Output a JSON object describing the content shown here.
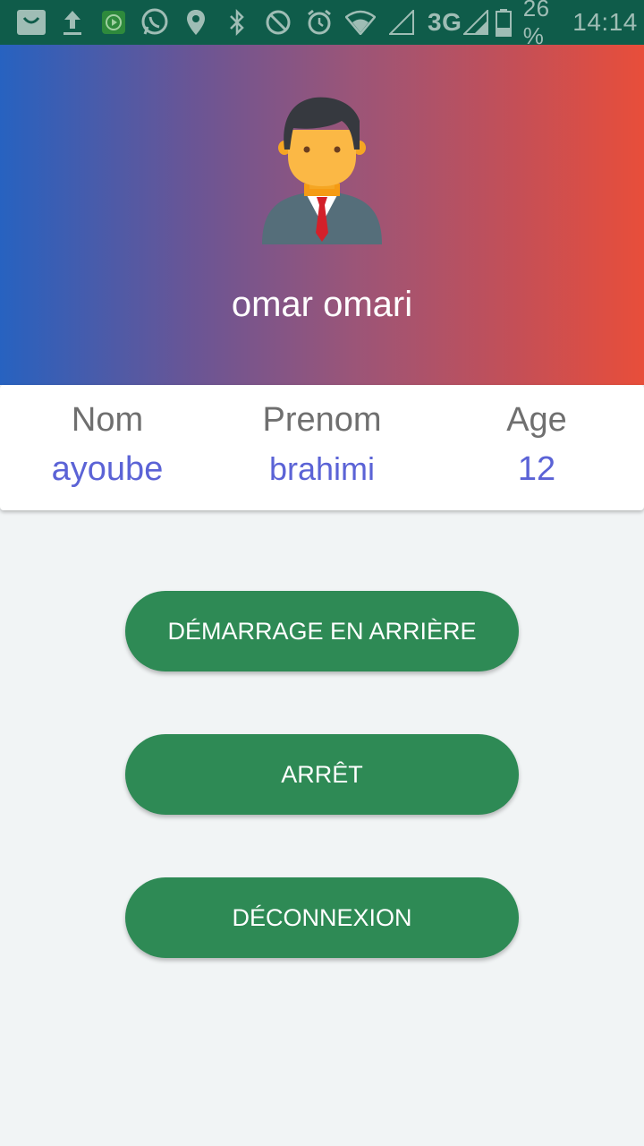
{
  "status_bar": {
    "icons_left": [
      "shopping-bag-icon",
      "upload-icon",
      "play-app-icon",
      "whatsapp-icon",
      "location-pin-icon",
      "bluetooth-icon",
      "do-not-disturb-icon",
      "alarm-icon",
      "wifi-icon",
      "signal-empty-icon"
    ],
    "network": "3G",
    "battery_percent": "26 %",
    "time": "14:14",
    "background_color": "#0f5c4a"
  },
  "header": {
    "avatar_icon": "businessman-avatar-icon",
    "user_name": "omar omari",
    "gradient_colors": [
      "#2762c0",
      "#9b5578",
      "#e84e3a"
    ]
  },
  "info_card": {
    "columns": [
      {
        "label": "Nom",
        "value": "ayoube"
      },
      {
        "label": "Prenom",
        "value": "brahimi"
      },
      {
        "label": "Age",
        "value": "12"
      }
    ],
    "value_color": "#5b63d6"
  },
  "buttons": {
    "background_start": "DÉMARRAGE EN ARRIÈRE",
    "stop": "ARRÊT",
    "logout": "DÉCONNEXION",
    "color": "#2e8a55"
  }
}
